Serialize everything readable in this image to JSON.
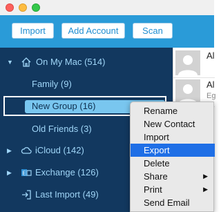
{
  "toolbar": {
    "import_label": "Import",
    "add_account_label": "Add Account",
    "scan_label": "Scan"
  },
  "sidebar": {
    "on_my_mac": "On My Mac (514)",
    "groups": [
      "Family (9)",
      "New Group (16)",
      "Old Friends (3)"
    ],
    "icloud": "iCloud (142)",
    "exchange": "Exchange (126)",
    "last_import": "Last Import (49)"
  },
  "contacts": [
    {
      "name": "Al",
      "sub": ""
    },
    {
      "name": "Al",
      "sub": "Eg"
    }
  ],
  "context_menu": {
    "items": [
      "Rename",
      "New Contact",
      "Import",
      "Export",
      "Delete",
      "Share",
      "Print",
      "Send Email"
    ],
    "highlighted": "Export"
  },
  "colors": {
    "toolbar": "#2a9bd8",
    "sidebar": "#12385f",
    "selection": "#79c6ef",
    "menu_highlight": "#1f6fe6"
  }
}
